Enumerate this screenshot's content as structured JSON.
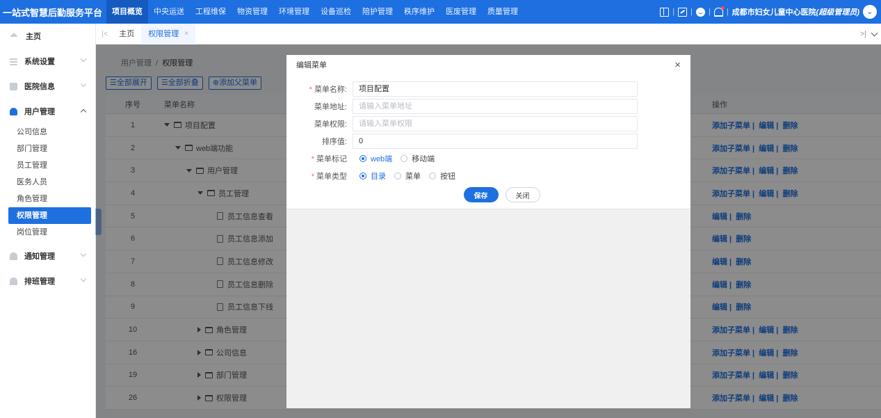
{
  "brand": "一站式智慧后勤服务平台",
  "nav": [
    "项目概览",
    "中央运送",
    "工程维保",
    "物资管理",
    "环境管理",
    "设备巡检",
    "陪护管理",
    "秩序维护",
    "医废管理",
    "质量管理"
  ],
  "nav_active_index": 0,
  "user": {
    "sep": "|",
    "hospital": "成都市妇女儿童中心医院",
    "role": "(超级管理员)"
  },
  "sidebar": {
    "home": "主页",
    "system": "系统设置",
    "hospital": "医院信息",
    "user_mgmt": "用户管理",
    "sub_items": [
      "公司信息",
      "部门管理",
      "员工管理",
      "医务人员",
      "角色管理",
      "权限管理",
      "岗位管理"
    ],
    "active_sub_index": 5,
    "notify": "通知管理",
    "schedule": "排班管理"
  },
  "tabs": {
    "home": "主页",
    "current": "权限管理",
    "close": "×",
    "left_arrow": "|<",
    "right_arrow": ">|"
  },
  "breadcrumb": {
    "parent": "用户管理",
    "sep": "/",
    "current": "权限管理"
  },
  "toolbar": {
    "expand_all": "☰全部展开",
    "collapse_all": "☰全部折叠",
    "add_parent": "⊕添加父菜单"
  },
  "table": {
    "headers": {
      "no": "序号",
      "name": "菜单名称",
      "ops": "操作"
    },
    "rows": [
      {
        "no": "1",
        "name": "项目配置",
        "level": 0,
        "kind": "folder",
        "expand": "down",
        "ops": "添加子菜单 |  编辑 |  删除"
      },
      {
        "no": "2",
        "name": "web端功能",
        "level": 1,
        "kind": "folder",
        "expand": "down",
        "ops": "添加子菜单 |  编辑 |  删除"
      },
      {
        "no": "3",
        "name": "用户管理",
        "level": 2,
        "kind": "folder",
        "expand": "down",
        "ops": "添加子菜单 |  编辑 |  删除"
      },
      {
        "no": "4",
        "name": "员工管理",
        "level": 3,
        "kind": "folder",
        "expand": "down",
        "ops": "添加子菜单 |  编辑 |  删除"
      },
      {
        "no": "5",
        "name": "员工信息查看",
        "level": 4,
        "kind": "file",
        "expand": "",
        "ops": "编辑 |  删除"
      },
      {
        "no": "6",
        "name": "员工信息添加",
        "level": 4,
        "kind": "file",
        "expand": "",
        "ops": "编辑 |  删除"
      },
      {
        "no": "7",
        "name": "员工信息修改",
        "level": 4,
        "kind": "file",
        "expand": "",
        "ops": "编辑 |  删除"
      },
      {
        "no": "8",
        "name": "员工信息删除",
        "level": 4,
        "kind": "file",
        "expand": "",
        "ops": "编辑 |  删除"
      },
      {
        "no": "9",
        "name": "员工信息下线",
        "level": 4,
        "kind": "file",
        "expand": "",
        "ops": "编辑 |  删除"
      },
      {
        "no": "10",
        "name": "角色管理",
        "level": 3,
        "kind": "folder",
        "expand": "right",
        "ops": "添加子菜单 |  编辑 |  删除"
      },
      {
        "no": "16",
        "name": "公司信息",
        "level": 3,
        "kind": "folder",
        "expand": "right",
        "ops": "添加子菜单 |  编辑 |  删除"
      },
      {
        "no": "19",
        "name": "部门管理",
        "level": 3,
        "kind": "folder",
        "expand": "right",
        "ops": "添加子菜单 |  编辑 |  删除"
      },
      {
        "no": "26",
        "name": "权限管理",
        "level": 3,
        "kind": "folder",
        "expand": "right",
        "ops": "添加子菜单 |  编辑 |  删除"
      }
    ]
  },
  "modal": {
    "title": "编辑菜单",
    "close": "×",
    "req_mark": "*",
    "name_label": "菜单名称:",
    "name_value": "项目配置",
    "url_label": "菜单地址:",
    "url_placeholder": "请输入菜单地址",
    "perm_label": "菜单权限:",
    "perm_placeholder": "请输入菜单权限",
    "sort_label": "排序值:",
    "sort_value": "0",
    "flag_label": "菜单标记",
    "flag_options": [
      "web端",
      "移动端"
    ],
    "flag_selected": 0,
    "type_label": "菜单类型",
    "type_options": [
      "目录",
      "菜单",
      "按钮"
    ],
    "type_selected": 0,
    "save": "保存",
    "close_btn": "关闭"
  },
  "colors": {
    "primary": "#1e6fe0",
    "required": "#f56c6c"
  }
}
